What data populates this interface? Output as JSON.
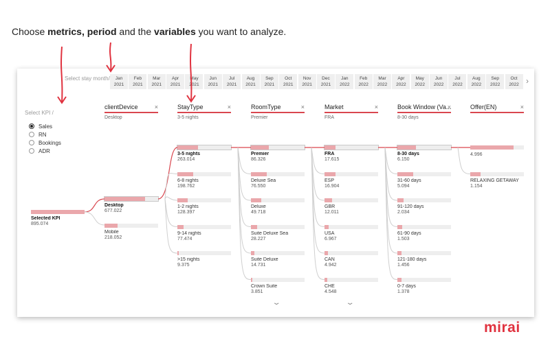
{
  "intro": {
    "p1": "Choose ",
    "b1": "metrics,",
    "p2": " ",
    "b2": "period",
    "p3": " and the ",
    "b3": "variables",
    "p4": " you want to analyze."
  },
  "months_label": "Select stay month/",
  "months": [
    {
      "m": "Jan",
      "y": "2021"
    },
    {
      "m": "Feb",
      "y": "2021"
    },
    {
      "m": "Mar",
      "y": "2021"
    },
    {
      "m": "Apr",
      "y": "2021"
    },
    {
      "m": "May",
      "y": "2021"
    },
    {
      "m": "Jun",
      "y": "2021"
    },
    {
      "m": "Jul",
      "y": "2021"
    },
    {
      "m": "Aug",
      "y": "2021"
    },
    {
      "m": "Sep",
      "y": "2021"
    },
    {
      "m": "Oct",
      "y": "2021"
    },
    {
      "m": "Nov",
      "y": "2021"
    },
    {
      "m": "Dec",
      "y": "2021"
    },
    {
      "m": "Jan",
      "y": "2022"
    },
    {
      "m": "Feb",
      "y": "2022"
    },
    {
      "m": "Mar",
      "y": "2022"
    },
    {
      "m": "Apr",
      "y": "2022"
    },
    {
      "m": "May",
      "y": "2022"
    },
    {
      "m": "Jun",
      "y": "2022"
    },
    {
      "m": "Jul",
      "y": "2022"
    },
    {
      "m": "Aug",
      "y": "2022"
    },
    {
      "m": "Sep",
      "y": "2022"
    },
    {
      "m": "Oct",
      "y": "2022"
    }
  ],
  "kpi": {
    "title": "Select KPI /",
    "options": [
      "Sales",
      "RN",
      "Bookings",
      "ADR"
    ],
    "selected": 0
  },
  "root": {
    "label": "Selected KPI",
    "value": "895.074",
    "share": 1
  },
  "columns": [
    {
      "title": "clientDevice",
      "selected": "Desktop",
      "nodes": [
        {
          "label": "Desktop",
          "value": "677.022",
          "share": 0.76,
          "selected": true
        },
        {
          "label": "Mobile",
          "value": "218.052",
          "share": 0.24
        }
      ]
    },
    {
      "title": "StayType",
      "selected": "3-5 nights",
      "nodes": [
        {
          "label": "3-5 nights",
          "value": "263.014",
          "share": 0.39,
          "selected": true
        },
        {
          "label": "6-8 nights",
          "value": "198.762",
          "share": 0.29
        },
        {
          "label": "1-2 nights",
          "value": "128.397",
          "share": 0.19
        },
        {
          "label": "9-14 nights",
          "value": "77.474",
          "share": 0.11
        },
        {
          "label": ">15 nights",
          "value": "9.375",
          "share": 0.02
        }
      ]
    },
    {
      "title": "RoomType",
      "selected": "Premier",
      "nodes": [
        {
          "label": "Premier",
          "value": "86.326",
          "share": 0.33,
          "selected": true
        },
        {
          "label": "Deluxe Sea",
          "value": "76.550",
          "share": 0.29
        },
        {
          "label": "Deluxe",
          "value": "49.718",
          "share": 0.19
        },
        {
          "label": "Suite Deluxe Sea",
          "value": "28.227",
          "share": 0.11
        },
        {
          "label": "Suite Deluxe",
          "value": "14.731",
          "share": 0.06
        },
        {
          "label": "Crown Suite",
          "value": "3.851",
          "share": 0.015
        }
      ]
    },
    {
      "title": "Market",
      "selected": "FRA",
      "nodes": [
        {
          "label": "FRA",
          "value": "17.615",
          "share": 0.2,
          "selected": true
        },
        {
          "label": "ESP",
          "value": "16.904",
          "share": 0.2
        },
        {
          "label": "GBR",
          "value": "12.011",
          "share": 0.14
        },
        {
          "label": "USA",
          "value": "6.967",
          "share": 0.08
        },
        {
          "label": "CAN",
          "value": "4.942",
          "share": 0.06
        },
        {
          "label": "CHE",
          "value": "4.548",
          "share": 0.05
        }
      ]
    },
    {
      "title": "Book Window (Va...",
      "selected": "8-30 days",
      "nodes": [
        {
          "label": "8-30 days",
          "value": "6.150",
          "share": 0.35,
          "selected": true
        },
        {
          "label": "31-60 days",
          "value": "5.094",
          "share": 0.29
        },
        {
          "label": "91-120 days",
          "value": "2.034",
          "share": 0.12
        },
        {
          "label": "61-90 days",
          "value": "1.503",
          "share": 0.09
        },
        {
          "label": "121-180 days",
          "value": "1.456",
          "share": 0.08
        },
        {
          "label": "0-7 days",
          "value": "1.378",
          "share": 0.08
        }
      ]
    },
    {
      "title": "Offer(EN)",
      "selected": "",
      "nodes": [
        {
          "label": "",
          "value": "4.996",
          "share": 0.81
        },
        {
          "label": "RELAXING GETAWAY",
          "value": "1.154",
          "share": 0.19
        }
      ]
    }
  ],
  "brand": "mirai",
  "colors": {
    "accent": "#d9464e",
    "bar_fill": "#eaa7ab",
    "bar_bg": "#eeeeee",
    "arrow": "#e0323f"
  },
  "icons": {
    "close": "close-icon",
    "next": "chevron-right-icon",
    "more": "chevron-down-icon"
  }
}
